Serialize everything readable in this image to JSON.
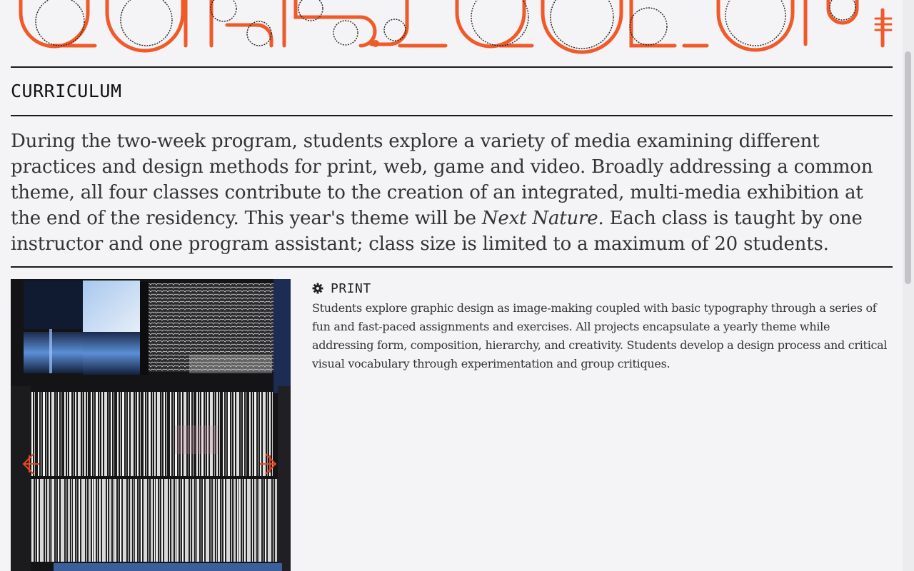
{
  "site": {
    "banner_logo": "logotype-banner"
  },
  "section": {
    "heading": "CURRICULUM",
    "intro_before": "During the two-week program, students explore a variety of media examining different practices and design methods for print, web, game and video. Broadly addressing a common theme, all four classes contribute to the creation of an integrated, multi-media exhibition at the end of the residency. This year's theme will be ",
    "theme": "Next Nature",
    "intro_after": ". Each class is taught by one instructor and one program assistant; class size is limited to a maximum of 20 students."
  },
  "course": {
    "icon": "gear-icon",
    "title": "PRINT",
    "description": "Students explore graphic design as image-making coupled with basic typography through a series of fun and fast-paced assignments and exercises. All projects encapsulate a yearly theme while addressing form, composition, hierarchy, and creativity. Students develop a design process and critical visual vocabulary through experimentation and group critiques."
  },
  "gallery": {
    "prev_icon": "arrow-left-icon",
    "next_icon": "arrow-right-icon"
  },
  "colors": {
    "accent": "#f05a28",
    "background": "#f4f3f6",
    "rule": "#1a1a1a"
  }
}
